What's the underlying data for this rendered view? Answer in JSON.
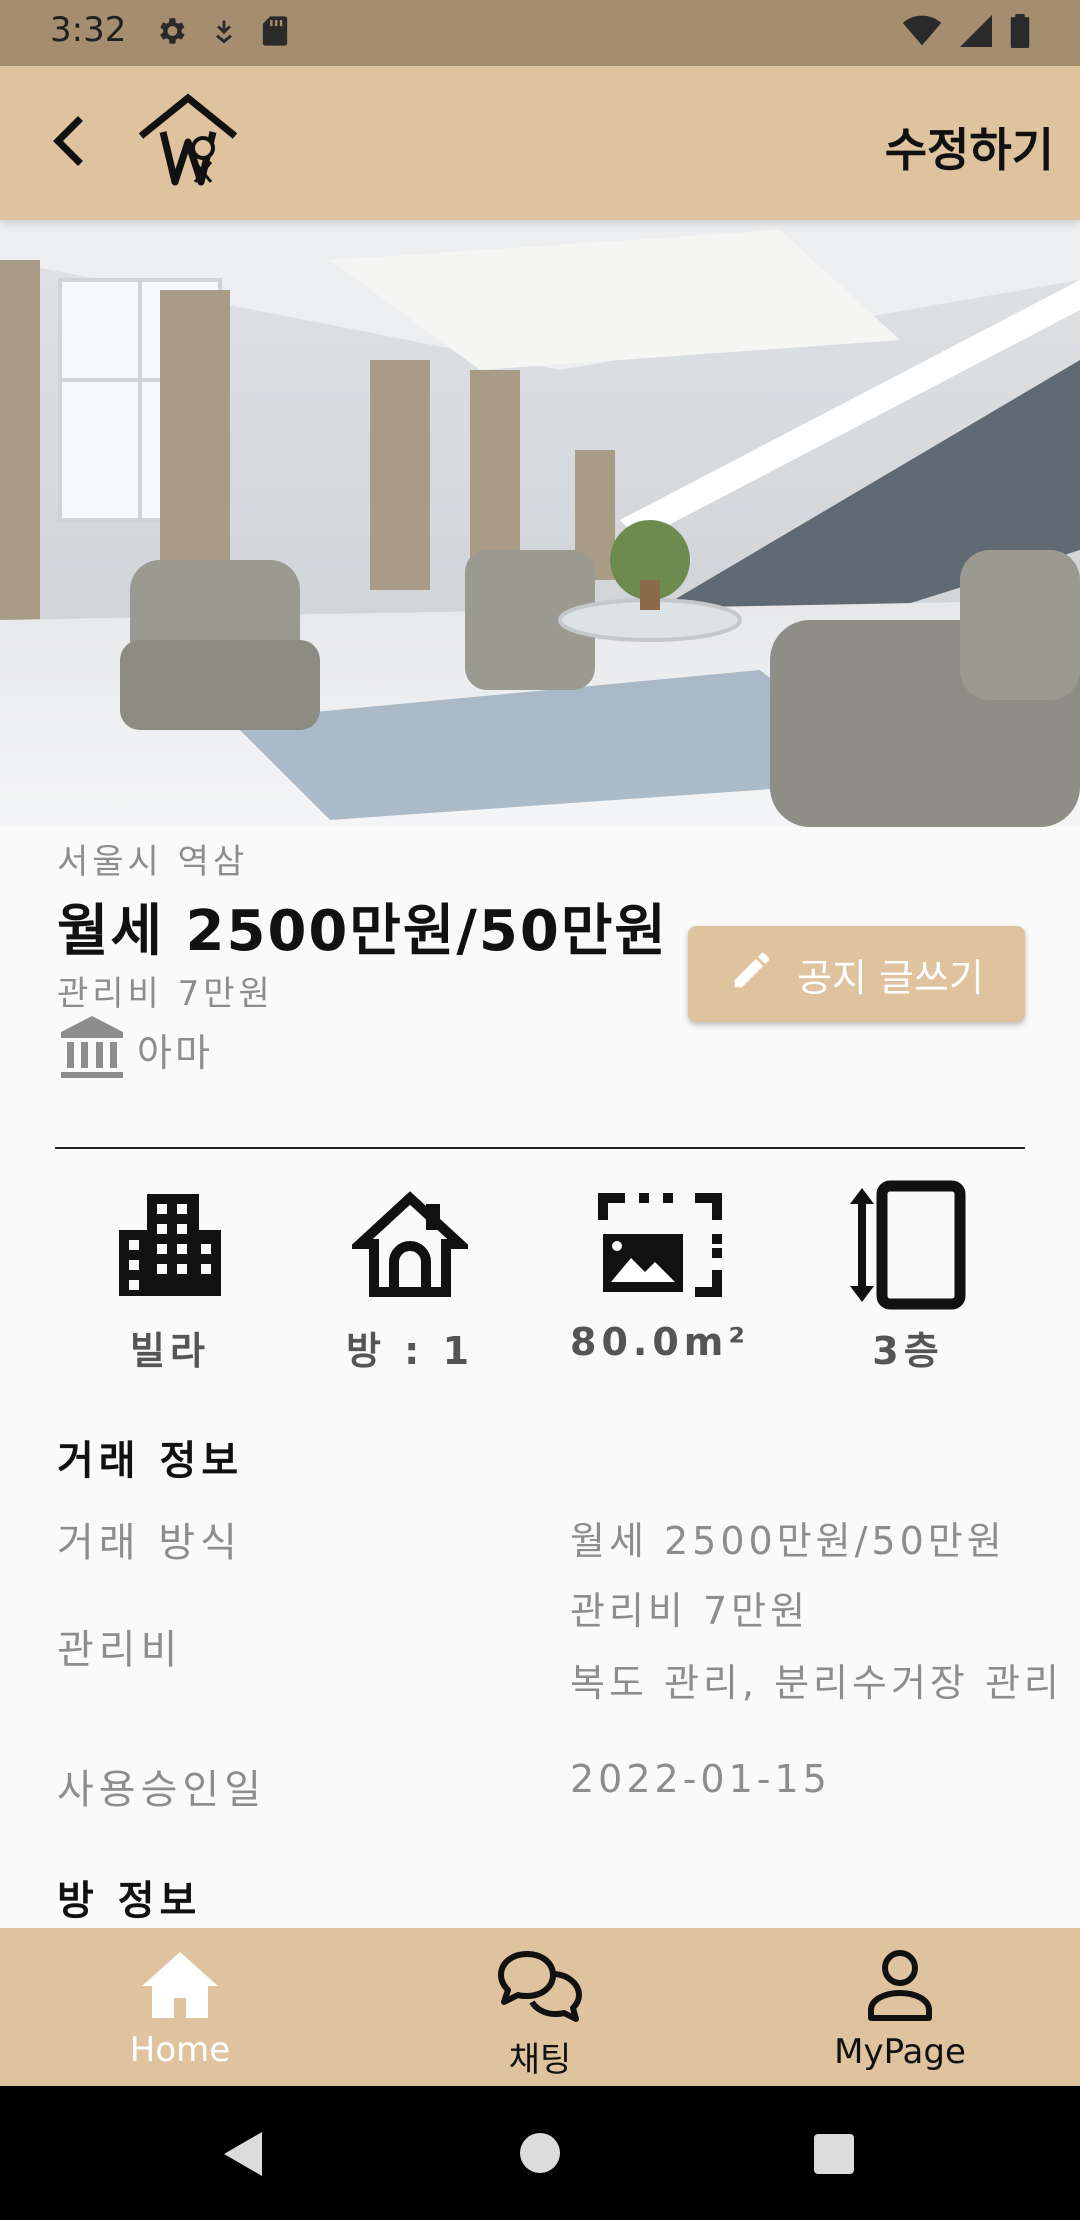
{
  "status_bar": {
    "time": "3:32"
  },
  "header": {
    "edit_label": "수정하기"
  },
  "listing": {
    "location": "서울시 역삼",
    "price": "월세 2500만원/50만원",
    "management_fee": "관리비 7만원",
    "agent_name": "아마"
  },
  "notice_button": {
    "label": "공지 글쓰기"
  },
  "features": [
    {
      "icon": "building-icon",
      "label": "빌라"
    },
    {
      "icon": "house-icon",
      "label": "방 : 1"
    },
    {
      "icon": "area-icon",
      "label": "80.0m²"
    },
    {
      "icon": "floor-icon",
      "label": "3층"
    }
  ],
  "trade_info": {
    "title": "거래 정보",
    "rows": [
      {
        "label": "거래 방식",
        "value": "월세 2500만원/50만원"
      },
      {
        "label": "관리비",
        "value": "관리비 7만원",
        "value2": "복도 관리, 분리수거장 관리"
      },
      {
        "label": "사용승인일",
        "value": "2022-01-15"
      }
    ]
  },
  "room_info": {
    "title": "방 정보"
  },
  "bottom_nav": [
    {
      "label": "Home",
      "icon": "home-icon",
      "active": true
    },
    {
      "label": "채팅",
      "icon": "chat-icon",
      "active": false
    },
    {
      "label": "MyPage",
      "icon": "person-icon",
      "active": false
    }
  ],
  "colors": {
    "accent": "#dfc39f",
    "status_bar": "#a58d70",
    "muted_text": "#8d8d8d"
  }
}
